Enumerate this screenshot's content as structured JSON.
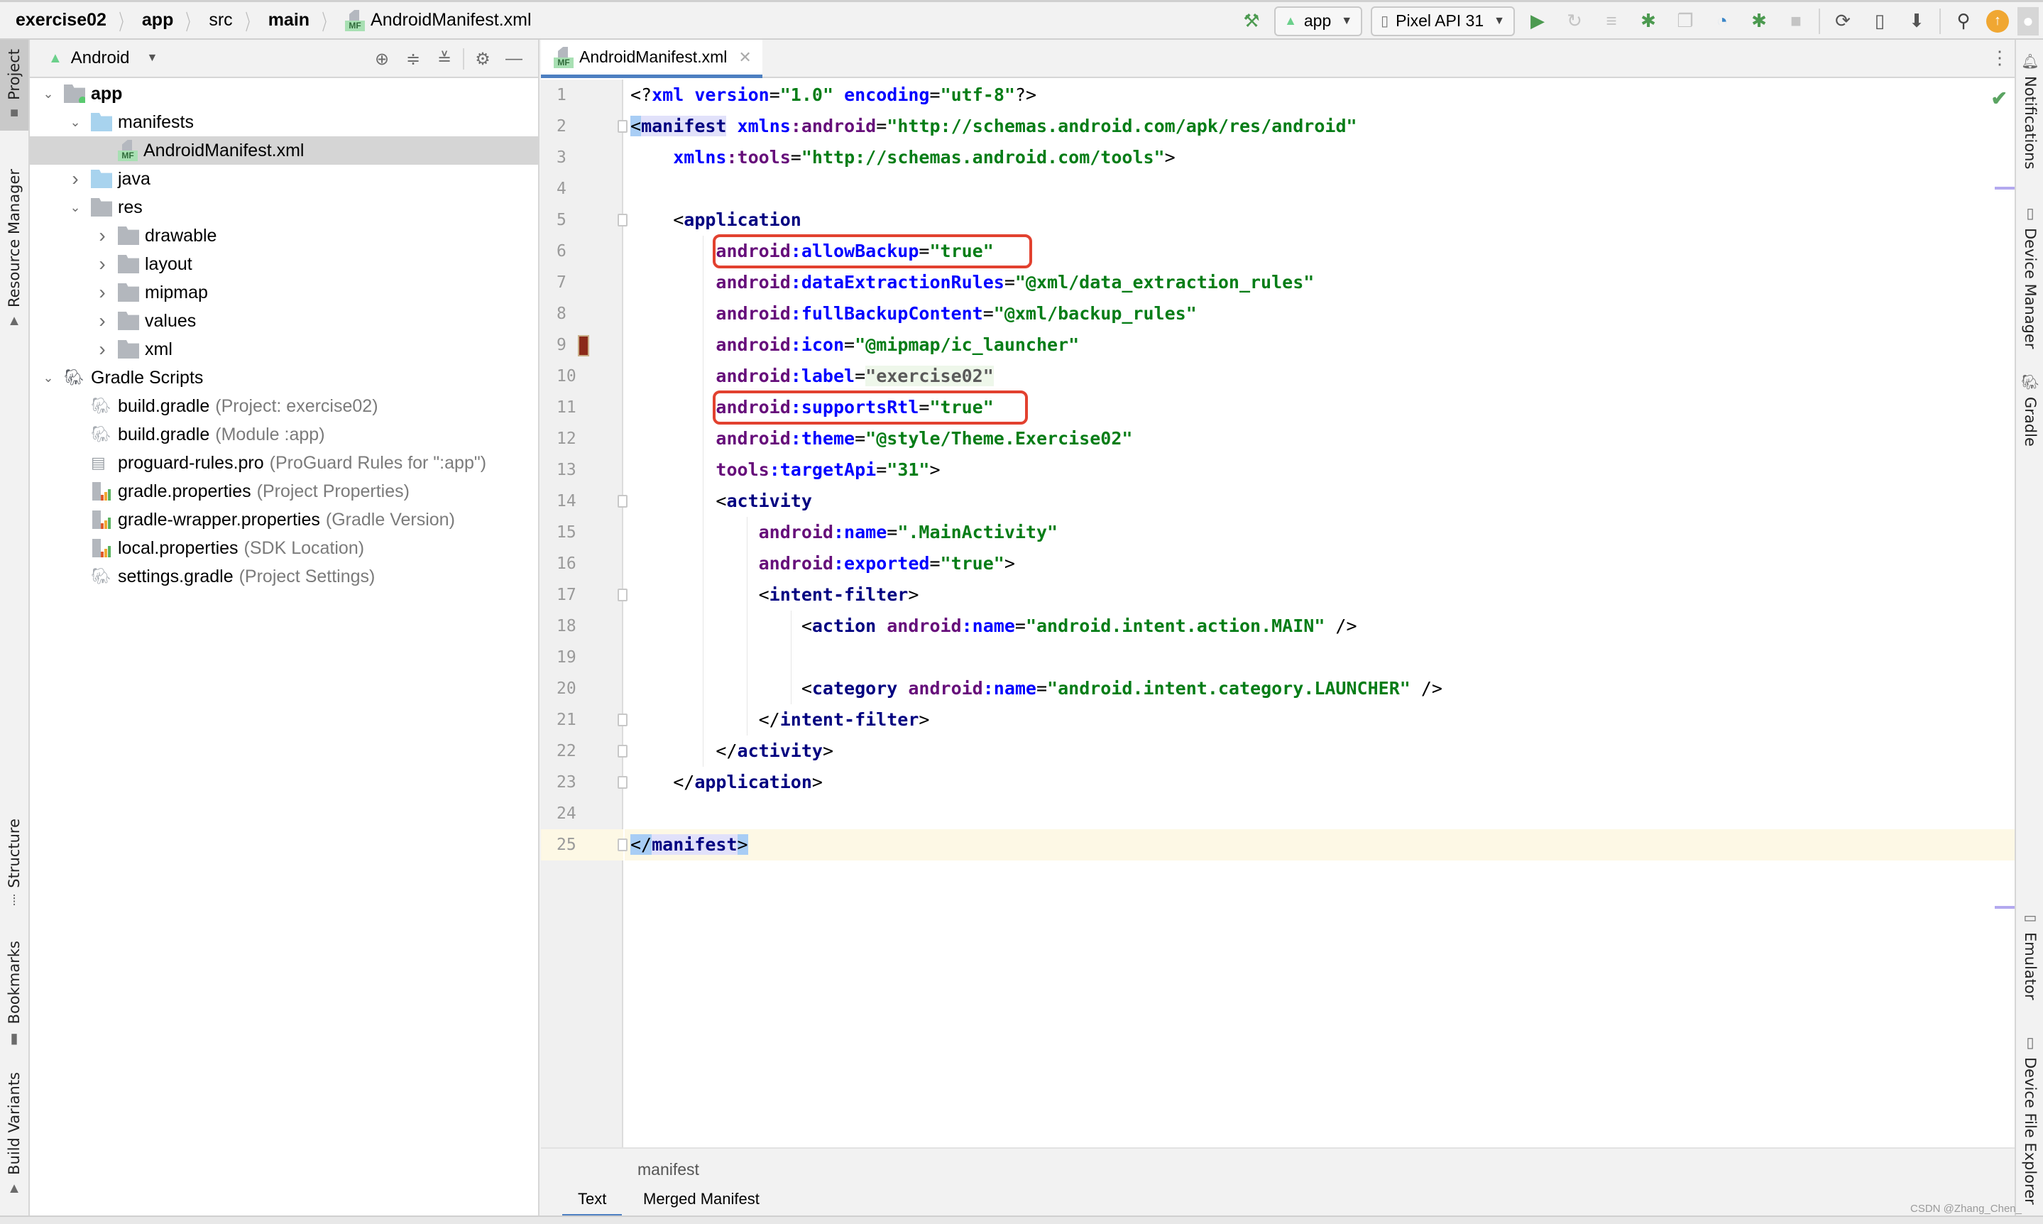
{
  "breadcrumb": {
    "items": [
      {
        "label": "exercise02",
        "bold": true
      },
      {
        "label": "app",
        "bold": true
      },
      {
        "label": "src",
        "bold": false
      },
      {
        "label": "main",
        "bold": true
      },
      {
        "label": "AndroidManifest.xml",
        "bold": false,
        "icon": "manifest-file-icon"
      }
    ],
    "mf_badge": "MF"
  },
  "toolbar": {
    "run_config": "app",
    "device": "Pixel API 31",
    "icons": [
      "hammer-icon",
      "run-icon",
      "apply-changes-icon",
      "apply-code-changes-icon",
      "debug-icon",
      "attach-debugger-icon",
      "profile-icon",
      "attach-process-icon",
      "stop-icon",
      "gradle-sync-icon",
      "device-manager-icon",
      "sdk-manager-icon",
      "search-icon",
      "update-icon",
      "account-icon"
    ],
    "accent_update": "#f0a732",
    "run_color": "#4c9a50"
  },
  "left_stripe": {
    "tabs": [
      {
        "label": "Project",
        "icon": "folder-icon",
        "active": true
      },
      {
        "label": "Resource Manager",
        "icon": "resource-manager-icon",
        "active": false
      },
      {
        "label": "Structure",
        "icon": "structure-icon",
        "active": false
      },
      {
        "label": "Bookmarks",
        "icon": "bookmark-icon",
        "active": false
      },
      {
        "label": "Build Variants",
        "icon": "build-variants-icon",
        "active": false
      }
    ]
  },
  "project_panel": {
    "view": "Android",
    "tools": [
      "locate-icon",
      "expand-all-icon",
      "collapse-all-icon",
      "gear-icon",
      "minimize-icon"
    ],
    "tree": [
      {
        "label": "app",
        "hint": "",
        "depth": 0,
        "arrow": "down",
        "icon": "module",
        "bold": true,
        "selected": false
      },
      {
        "label": "manifests",
        "hint": "",
        "depth": 1,
        "arrow": "down",
        "icon": "folder-blue",
        "bold": false,
        "selected": false
      },
      {
        "label": "AndroidManifest.xml",
        "hint": "",
        "depth": 2,
        "arrow": "",
        "icon": "manifest",
        "bold": false,
        "selected": true
      },
      {
        "label": "java",
        "hint": "",
        "depth": 1,
        "arrow": "right",
        "icon": "folder-blue",
        "bold": false,
        "selected": false
      },
      {
        "label": "res",
        "hint": "",
        "depth": 1,
        "arrow": "down",
        "icon": "res-folder",
        "bold": false,
        "selected": false
      },
      {
        "label": "drawable",
        "hint": "",
        "depth": 2,
        "arrow": "right",
        "icon": "folder-gray",
        "bold": false,
        "selected": false
      },
      {
        "label": "layout",
        "hint": "",
        "depth": 2,
        "arrow": "right",
        "icon": "folder-gray",
        "bold": false,
        "selected": false
      },
      {
        "label": "mipmap",
        "hint": "",
        "depth": 2,
        "arrow": "right",
        "icon": "folder-gray",
        "bold": false,
        "selected": false
      },
      {
        "label": "values",
        "hint": "",
        "depth": 2,
        "arrow": "right",
        "icon": "folder-gray",
        "bold": false,
        "selected": false
      },
      {
        "label": "xml",
        "hint": "",
        "depth": 2,
        "arrow": "right",
        "icon": "folder-gray",
        "bold": false,
        "selected": false
      },
      {
        "label": "Gradle Scripts",
        "hint": "",
        "depth": 0,
        "arrow": "down",
        "icon": "gradle",
        "bold": false,
        "selected": false
      },
      {
        "label": "build.gradle",
        "hint": "(Project: exercise02)",
        "depth": 1,
        "arrow": "",
        "icon": "gradle-file",
        "bold": false,
        "selected": false
      },
      {
        "label": "build.gradle",
        "hint": "(Module :app)",
        "depth": 1,
        "arrow": "",
        "icon": "gradle-file",
        "bold": false,
        "selected": false
      },
      {
        "label": "proguard-rules.pro",
        "hint": "(ProGuard Rules for \":app\")",
        "depth": 1,
        "arrow": "",
        "icon": "text-file",
        "bold": false,
        "selected": false
      },
      {
        "label": "gradle.properties",
        "hint": "(Project Properties)",
        "depth": 1,
        "arrow": "",
        "icon": "properties-file",
        "bold": false,
        "selected": false
      },
      {
        "label": "gradle-wrapper.properties",
        "hint": "(Gradle Version)",
        "depth": 1,
        "arrow": "",
        "icon": "properties-file",
        "bold": false,
        "selected": false
      },
      {
        "label": "local.properties",
        "hint": "(SDK Location)",
        "depth": 1,
        "arrow": "",
        "icon": "properties-file",
        "bold": false,
        "selected": false
      },
      {
        "label": "settings.gradle",
        "hint": "(Project Settings)",
        "depth": 1,
        "arrow": "",
        "icon": "gradle-file",
        "bold": false,
        "selected": false
      }
    ]
  },
  "editor": {
    "tab_label": "AndroidManifest.xml",
    "current_line": 25,
    "highlighted_lines": [
      6,
      11
    ],
    "highlight_color": "#e2412f",
    "lines": [
      {
        "n": 1,
        "tokens": [
          [
            "pun",
            "<?"
          ],
          [
            "attr",
            "xml"
          ],
          [
            "pun",
            " "
          ],
          [
            "attr",
            "version"
          ],
          [
            "pun",
            "="
          ],
          [
            "val",
            "\"1.0\""
          ],
          [
            "pun",
            " "
          ],
          [
            "attr",
            "encoding"
          ],
          [
            "pun",
            "="
          ],
          [
            "val",
            "\"utf-8\""
          ],
          [
            "pun",
            "?>"
          ]
        ]
      },
      {
        "n": 2,
        "tokens": [
          [
            "brace",
            "<"
          ],
          [
            "taghl",
            "manifest"
          ],
          [
            "pun",
            " "
          ],
          [
            "attr",
            "xmlns"
          ],
          [
            "ns",
            ":android"
          ],
          [
            "pun",
            "="
          ],
          [
            "val",
            "\"http://schemas.android.com/apk/res/android\""
          ]
        ]
      },
      {
        "n": 3,
        "tokens": [
          [
            "pun",
            "    "
          ],
          [
            "attr",
            "xmlns"
          ],
          [
            "ns",
            ":tools"
          ],
          [
            "pun",
            "="
          ],
          [
            "val",
            "\"http://schemas.android.com/tools\""
          ],
          [
            "pun",
            ">"
          ]
        ]
      },
      {
        "n": 4,
        "tokens": []
      },
      {
        "n": 5,
        "tokens": [
          [
            "pun",
            "    <"
          ],
          [
            "tag",
            "application"
          ]
        ]
      },
      {
        "n": 6,
        "tokens": [
          [
            "pun",
            "        "
          ],
          [
            "ns",
            "android"
          ],
          [
            "attr",
            ":allowBackup"
          ],
          [
            "pun",
            "="
          ],
          [
            "val",
            "\"true\""
          ]
        ]
      },
      {
        "n": 7,
        "tokens": [
          [
            "pun",
            "        "
          ],
          [
            "ns",
            "android"
          ],
          [
            "attr",
            ":dataExtractionRules"
          ],
          [
            "pun",
            "="
          ],
          [
            "val",
            "\"@xml/data_extraction_rules\""
          ]
        ]
      },
      {
        "n": 8,
        "tokens": [
          [
            "pun",
            "        "
          ],
          [
            "ns",
            "android"
          ],
          [
            "attr",
            ":fullBackupContent"
          ],
          [
            "pun",
            "="
          ],
          [
            "val",
            "\"@xml/backup_rules\""
          ]
        ]
      },
      {
        "n": 9,
        "tokens": [
          [
            "pun",
            "        "
          ],
          [
            "ns",
            "android"
          ],
          [
            "attr",
            ":icon"
          ],
          [
            "pun",
            "="
          ],
          [
            "val",
            "\"@mipmap/ic_launcher\""
          ]
        ]
      },
      {
        "n": 10,
        "tokens": [
          [
            "pun",
            "        "
          ],
          [
            "ns",
            "android"
          ],
          [
            "attr",
            ":label"
          ],
          [
            "pun",
            "="
          ],
          [
            "gray",
            "\"exercise02\""
          ]
        ]
      },
      {
        "n": 11,
        "tokens": [
          [
            "pun",
            "        "
          ],
          [
            "ns",
            "android"
          ],
          [
            "attr",
            ":supportsRtl"
          ],
          [
            "pun",
            "="
          ],
          [
            "val",
            "\"true\""
          ]
        ]
      },
      {
        "n": 12,
        "tokens": [
          [
            "pun",
            "        "
          ],
          [
            "ns",
            "android"
          ],
          [
            "attr",
            ":theme"
          ],
          [
            "pun",
            "="
          ],
          [
            "val",
            "\"@style/Theme.Exercise02\""
          ]
        ]
      },
      {
        "n": 13,
        "tokens": [
          [
            "pun",
            "        "
          ],
          [
            "ns",
            "tools"
          ],
          [
            "attr",
            ":targetApi"
          ],
          [
            "pun",
            "="
          ],
          [
            "val",
            "\"31\""
          ],
          [
            "pun",
            ">"
          ]
        ]
      },
      {
        "n": 14,
        "tokens": [
          [
            "pun",
            "        <"
          ],
          [
            "tag",
            "activity"
          ]
        ]
      },
      {
        "n": 15,
        "tokens": [
          [
            "pun",
            "            "
          ],
          [
            "ns",
            "android"
          ],
          [
            "attr",
            ":name"
          ],
          [
            "pun",
            "="
          ],
          [
            "val",
            "\".MainActivity\""
          ]
        ]
      },
      {
        "n": 16,
        "tokens": [
          [
            "pun",
            "            "
          ],
          [
            "ns",
            "android"
          ],
          [
            "attr",
            ":exported"
          ],
          [
            "pun",
            "="
          ],
          [
            "val",
            "\"true\""
          ],
          [
            "pun",
            ">"
          ]
        ]
      },
      {
        "n": 17,
        "tokens": [
          [
            "pun",
            "            <"
          ],
          [
            "tag",
            "intent-filter"
          ],
          [
            "pun",
            ">"
          ]
        ]
      },
      {
        "n": 18,
        "tokens": [
          [
            "pun",
            "                <"
          ],
          [
            "tag",
            "action"
          ],
          [
            "pun",
            " "
          ],
          [
            "ns",
            "android"
          ],
          [
            "attr",
            ":name"
          ],
          [
            "pun",
            "="
          ],
          [
            "val",
            "\"android.intent.action.MAIN\""
          ],
          [
            "pun",
            " />"
          ]
        ]
      },
      {
        "n": 19,
        "tokens": []
      },
      {
        "n": 20,
        "tokens": [
          [
            "pun",
            "                <"
          ],
          [
            "tag",
            "category"
          ],
          [
            "pun",
            " "
          ],
          [
            "ns",
            "android"
          ],
          [
            "attr",
            ":name"
          ],
          [
            "pun",
            "="
          ],
          [
            "val",
            "\"android.intent.category.LAUNCHER\""
          ],
          [
            "pun",
            " />"
          ]
        ]
      },
      {
        "n": 21,
        "tokens": [
          [
            "pun",
            "            </"
          ],
          [
            "tag",
            "intent-filter"
          ],
          [
            "pun",
            ">"
          ]
        ]
      },
      {
        "n": 22,
        "tokens": [
          [
            "pun",
            "        </"
          ],
          [
            "tag",
            "activity"
          ],
          [
            "pun",
            ">"
          ]
        ]
      },
      {
        "n": 23,
        "tokens": [
          [
            "pun",
            "    </"
          ],
          [
            "tag",
            "application"
          ],
          [
            "pun",
            ">"
          ]
        ]
      },
      {
        "n": 24,
        "tokens": []
      },
      {
        "n": 25,
        "tokens": [
          [
            "brace",
            "</"
          ],
          [
            "taghl",
            "manifest"
          ],
          [
            "brace",
            ">"
          ]
        ]
      }
    ],
    "bottom_breadcrumb": "manifest",
    "bottom_tabs": [
      {
        "label": "Text",
        "active": true
      },
      {
        "label": "Merged Manifest",
        "active": false
      }
    ]
  },
  "right_stripe": {
    "tabs": [
      {
        "label": "Notifications",
        "icon": "notifications-bell-icon"
      },
      {
        "label": "Device Manager",
        "icon": "device-manager-icon"
      },
      {
        "label": "Gradle",
        "icon": "gradle-elephant-icon"
      },
      {
        "label": "Emulator",
        "icon": "emulator-icon"
      },
      {
        "label": "Device File Explorer",
        "icon": "device-file-explorer-icon"
      }
    ]
  },
  "watermark": "CSDN @Zhang_Chen_"
}
